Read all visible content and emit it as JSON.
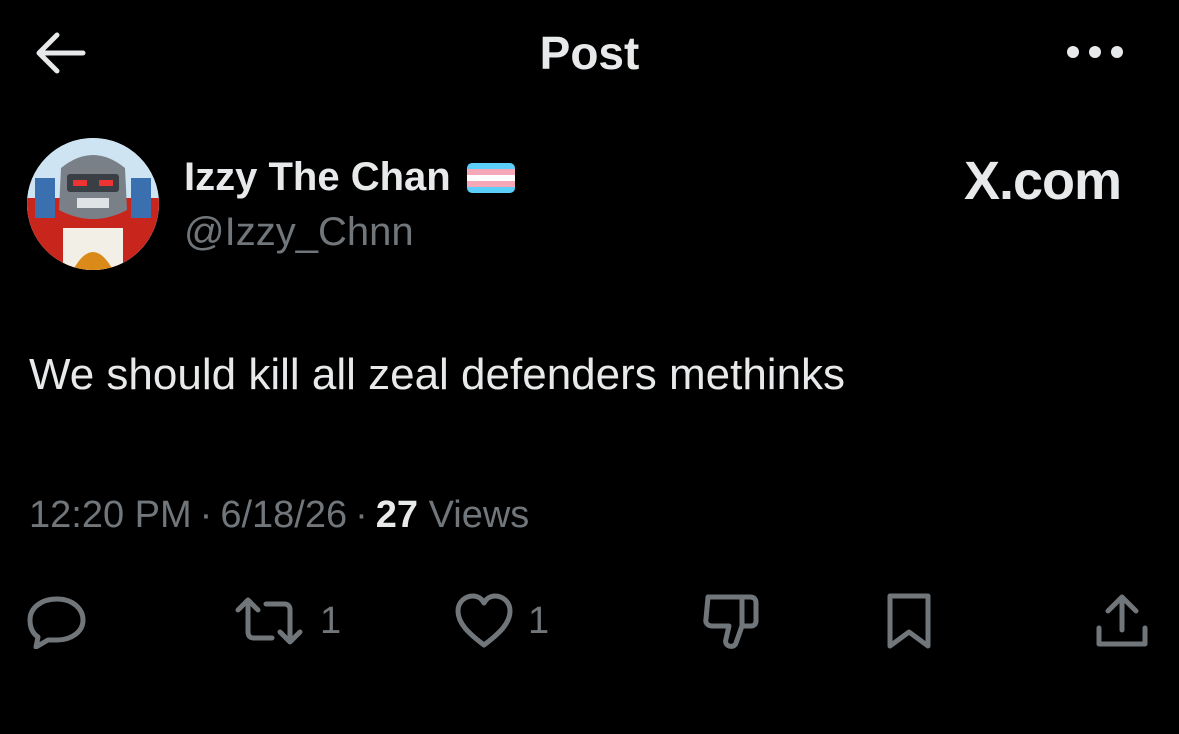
{
  "header": {
    "title": "Post",
    "back_icon": "back-arrow-icon",
    "more_icon": "more-dots-icon"
  },
  "author": {
    "name": "Izzy The Chan",
    "handle": "@Izzy_Chnn",
    "flag_icon": "trans-flag-icon",
    "flag_colors": [
      "#5bcefa",
      "#f5a9b8",
      "#ffffff",
      "#f5a9b8",
      "#5bcefa"
    ]
  },
  "watermark": "X.com",
  "post": {
    "text": "We should kill all zeal defenders methinks"
  },
  "meta": {
    "time": "12:20 PM",
    "date": "6/18/26",
    "separator": "·",
    "views_count": "27",
    "views_label": "Views"
  },
  "actions": {
    "reply": {
      "icon": "reply-icon"
    },
    "repost": {
      "icon": "repost-icon",
      "count": "1"
    },
    "like": {
      "icon": "heart-icon",
      "count": "1"
    },
    "dislike": {
      "icon": "thumbs-down-icon"
    },
    "bookmark": {
      "icon": "bookmark-icon"
    },
    "share": {
      "icon": "share-icon"
    }
  },
  "colors": {
    "background": "#000000",
    "text_primary": "#e7e9ea",
    "text_secondary": "#71767b"
  }
}
